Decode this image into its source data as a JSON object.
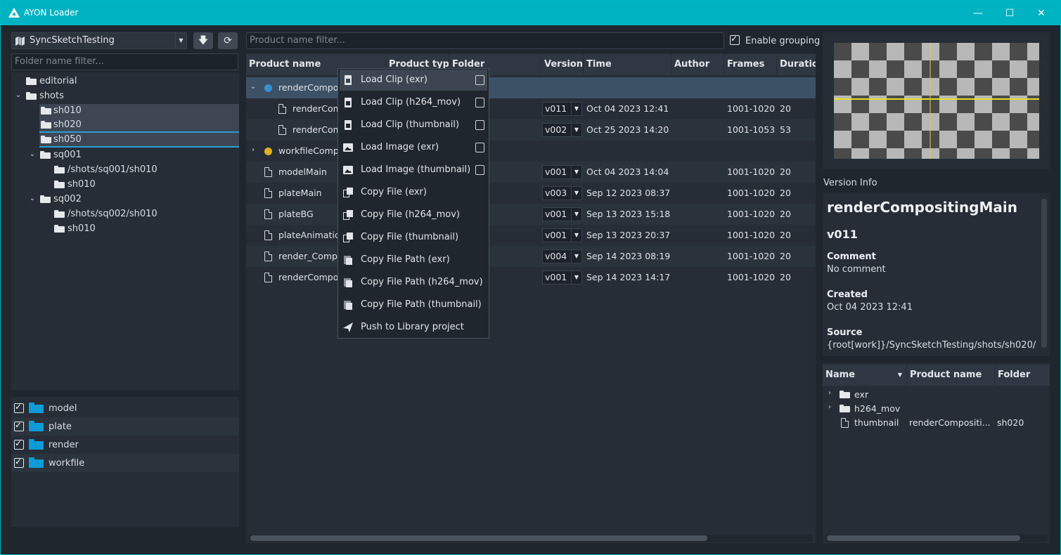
{
  "window": {
    "title": "AYON Loader",
    "minimize": "—",
    "maximize": "☐",
    "close": "✕"
  },
  "left": {
    "project": "SyncSketchTesting",
    "folder_filter_placeholder": "Folder name filter...",
    "tree": [
      {
        "label": "editorial"
      },
      {
        "label": "shots"
      },
      {
        "label": "sh010"
      },
      {
        "label": "sh020"
      },
      {
        "label": "sh050"
      },
      {
        "label": "sq001"
      },
      {
        "label": "/shots/sq001/sh010"
      },
      {
        "label": "sh010"
      },
      {
        "label": "sq002"
      },
      {
        "label": "/shots/sq002/sh010"
      },
      {
        "label": "sh010"
      }
    ],
    "product_types": [
      {
        "label": "model",
        "checked": true
      },
      {
        "label": "plate",
        "checked": true
      },
      {
        "label": "render",
        "checked": true
      },
      {
        "label": "workfile",
        "checked": true
      }
    ]
  },
  "center": {
    "product_filter_placeholder": "Product name filter...",
    "enable_grouping": "Enable grouping",
    "columns": [
      "Product name",
      "Product type",
      "Folder",
      "Version",
      "Time",
      "Author",
      "Frames",
      "Duratio"
    ],
    "rows": [
      {
        "name": "renderCompo",
        "version": "",
        "time": "",
        "frames": "",
        "duration": ""
      },
      {
        "name": "renderCom",
        "version": "v011",
        "time": "Oct 04 2023 12:41",
        "frames": "1001-1020",
        "duration": "20"
      },
      {
        "name": "renderCom",
        "version": "v002",
        "time": "Oct 25 2023 14:20",
        "frames": "1001-1053",
        "duration": "53"
      },
      {
        "name": "workfileComp",
        "version": "",
        "time": "",
        "frames": "",
        "duration": ""
      },
      {
        "name": "modelMain",
        "version": "v001",
        "time": "Oct 04 2023 14:04",
        "frames": "1001-1020",
        "duration": "20"
      },
      {
        "name": "plateMain",
        "version": "v003",
        "time": "Sep 12 2023 08:37",
        "frames": "1001-1020",
        "duration": "20"
      },
      {
        "name": "plateBG",
        "version": "v001",
        "time": "Sep 13 2023 15:18",
        "frames": "1001-1020",
        "duration": "20"
      },
      {
        "name": "plateAnimatic",
        "version": "v001",
        "time": "Sep 13 2023 20:37",
        "frames": "1001-1020",
        "duration": "20"
      },
      {
        "name": "render_Compo",
        "version": "v004",
        "time": "Sep 14 2023 08:19",
        "frames": "1001-1020",
        "duration": "20"
      },
      {
        "name": "renderCompo",
        "version": "v001",
        "time": "Sep 14 2023 14:17",
        "frames": "1001-1020",
        "duration": "20"
      }
    ]
  },
  "menu": [
    {
      "label": "Load Clip (exr)",
      "icon": "clip-icon"
    },
    {
      "label": "Load Clip (h264_mov)",
      "icon": "clip-icon"
    },
    {
      "label": "Load Clip (thumbnail)",
      "icon": "clip-icon"
    },
    {
      "label": "Load Image (exr)",
      "icon": "image-icon"
    },
    {
      "label": "Load Image (thumbnail)",
      "icon": "image-icon"
    },
    {
      "label": "Copy File (exr)",
      "icon": "copy-icon"
    },
    {
      "label": "Copy File (h264_mov)",
      "icon": "copy-icon"
    },
    {
      "label": "Copy File (thumbnail)",
      "icon": "copy-icon"
    },
    {
      "label": "Copy File Path (exr)",
      "icon": "clipboard-icon"
    },
    {
      "label": "Copy File Path (h264_mov)",
      "icon": "clipboard-icon"
    },
    {
      "label": "Copy File Path (thumbnail)",
      "icon": "clipboard-icon"
    },
    {
      "label": "Push to Library project",
      "icon": "send-icon"
    }
  ],
  "right": {
    "version_info_label": "Version Info",
    "product_name": "renderCompositingMain",
    "version": "v011",
    "comment_label": "Comment",
    "comment_value": "No comment",
    "created_label": "Created",
    "created_value": "Oct 04 2023 12:41",
    "source_label": "Source",
    "source_value": "{root[work]}/SyncSketchTesting/shots/sh020/",
    "rep_columns": [
      "Name",
      "Product name",
      "Folder"
    ],
    "reps": [
      {
        "name": "exr",
        "product": "",
        "folder": ""
      },
      {
        "name": "h264_mov",
        "product": "",
        "folder": ""
      },
      {
        "name": "thumbnail",
        "product": "renderCompositi...",
        "folder": "sh020"
      }
    ]
  }
}
